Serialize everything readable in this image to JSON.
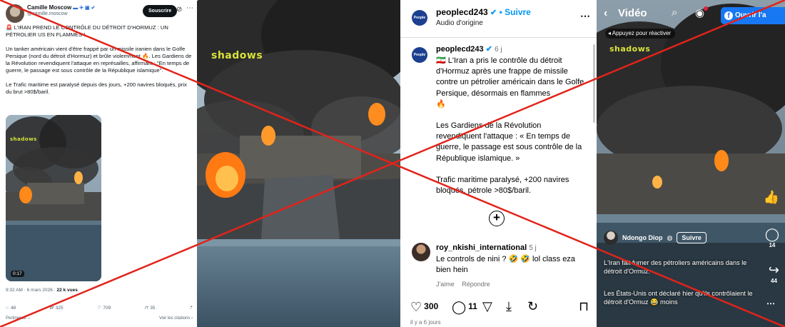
{
  "tweet": {
    "user_name": "Camille Moscow",
    "flags": "▬ ✈ ▣ ✔",
    "handle": "@camille.moscow",
    "subscribe_label": "Souscrire",
    "paragraphs": [
      "🚨 L'IRAN PREND LE CONTRÔLE DU DÉTROIT D'HORMUZ : UN PÉTROLIER US EN FLAMMES !",
      "Un tanker américain vient d'être frappé par un missile iranien dans le Golfe Persique (nord du détroit d'Hormuz) et brûle violemment 🔥. Les Gardiens de la Révolution revendiquent l'attaque en représailles, affirmant : \"En temps de guerre, le passage est sous contrôle de la République islamique\".",
      "Le Trafic maritime est paralysé depuis des jours, +200 navires bloqués, prix du brut >80$/baril."
    ],
    "video_duration": "0:17",
    "watermark": "shadows",
    "timestamp": "9:32 AM · 6 mars 2026 · ",
    "views": "22 k vues",
    "actions": {
      "replies": "48",
      "retweets": "325",
      "likes": "709",
      "bookmarks": "35"
    },
    "pertinence_label": "Pertinence ⌵",
    "quotes_label": "Voir les citations ›"
  },
  "video_still": {
    "watermark": "shadows"
  },
  "instagram": {
    "logo_text": "People CD",
    "account": "peoplecd243",
    "follow_label": "• Suivre",
    "audio_label": "Audio d'origine",
    "caption_age": "6 j",
    "caption_paragraphs": [
      "🇮🇷 L'Iran a pris le contrôle du détroit d'Hormuz après une frappe de missile contre un pétrolier américain dans le Golfe Persique, désormais en flammes",
      "Les Gardiens de la Révolution revendiquent l'attaque : « En temps de guerre, le passage est sous contrôle de la République islamique. »",
      "Trafic maritime paralysé, +200 navires bloqués, pétrole >80$/baril."
    ],
    "comment": {
      "user": "roy_nkishi_international",
      "age": "5 j",
      "text": "Le controls de nini ? 🤣 🤣 lol class eza bien hein",
      "like_label": "J'aime",
      "reply_label": "Répondre"
    },
    "likes": "300",
    "comments": "11",
    "posted_ago": "il y a 6 jours"
  },
  "facebook": {
    "title": "Vidéo",
    "open_label": "Ouvrir l'a",
    "tap_hint": "◂ Appuyez pour réactiver",
    "watermark": "shadows",
    "author": "Ndongo Diop",
    "follow_label": "Suivre",
    "comments_count": "14",
    "shares_count": "44",
    "description_1": "L'Iran fait fumer des pétroliers américains dans le détroit d'Ormuz.",
    "description_2": "Les États-Unis ont déclaré hier qu'ils contrôlaient le détroit d'Ormuz 😂 moins"
  },
  "colors": {
    "cross": "#e2231a",
    "ig_blue": "#0095f6",
    "fb_blue": "#1877f2",
    "watermark_yellow": "#d9e33a",
    "watermark_green": "#7bdc3a"
  }
}
